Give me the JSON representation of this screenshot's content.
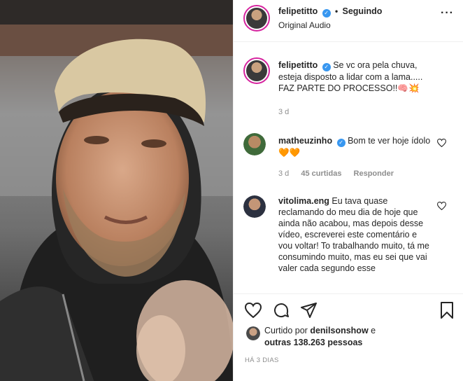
{
  "post": {
    "username": "felipetitto",
    "follow_status": "Seguindo",
    "audio": "Original Audio"
  },
  "caption": {
    "username": "felipetitto",
    "text": "Se vc ora pela chuva, esteja disposto a lidar com a lama..... FAZ PARTE DO PROCESSO!!🧠💥",
    "time": "3 d"
  },
  "comments": [
    {
      "username": "matheuzinho",
      "text": "Bom te ver hoje ídolo 🧡🧡",
      "time": "3 d",
      "likes": "45 curtidas",
      "reply": "Responder"
    },
    {
      "username": "vitolima.eng",
      "text": "Eu tava quase reclamando do meu dia de hoje que ainda não acabou, mas depois desse vídeo, escreverei este comentário e vou voltar! To trabalhando muito, tá me consumindo muito, mas eu sei que vai valer cada segundo esse"
    }
  ],
  "likes": {
    "prefix": "Curtido por",
    "user": "denilsonshow",
    "conj": "e",
    "others": "outras 138.263 pessoas"
  },
  "timestamp": "HÁ 3 DIAS",
  "colors": {
    "verified": "#3897f0",
    "story_ring": "#d6249f",
    "orange_heart": "#f08a24"
  }
}
